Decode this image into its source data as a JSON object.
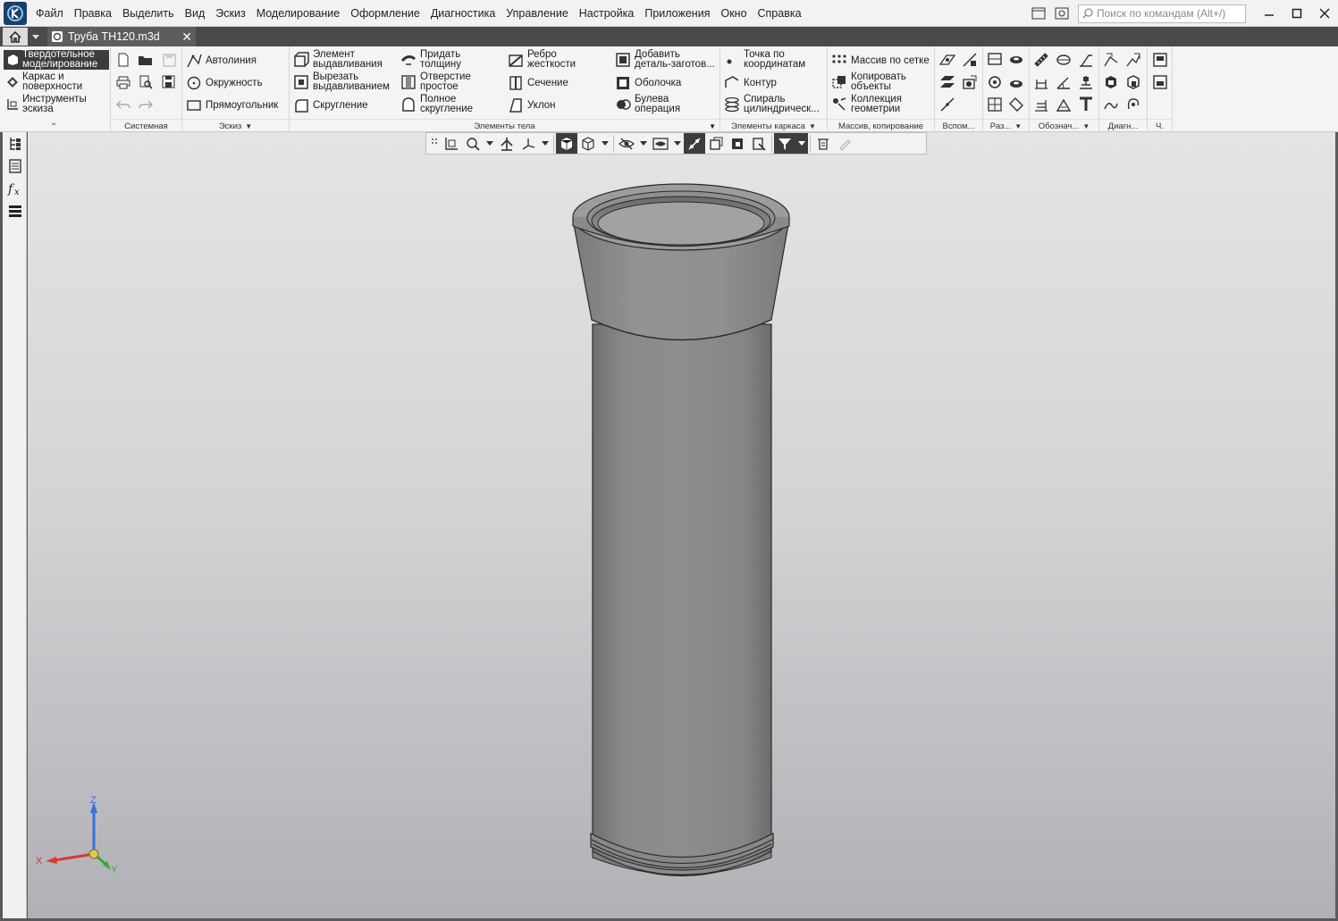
{
  "app": {
    "logo_name": "kompas-logo-icon",
    "menu": [
      "Файл",
      "Правка",
      "Выделить",
      "Вид",
      "Эскиз",
      "Моделирование",
      "Оформление",
      "Диагностика",
      "Управление",
      "Настройка",
      "Приложения",
      "Окно",
      "Справка"
    ],
    "search_placeholder": "Поиск по командам (Alt+/)",
    "minimize": "—",
    "maximize": "☐",
    "close": "✕"
  },
  "tabs": {
    "document_title": "Труба ТН120.m3d",
    "close": "✕"
  },
  "ribbon": {
    "modes": [
      "Твердотельное\nмоделирование",
      "Каркас и\nповерхности",
      "Инструменты\nэскиза"
    ],
    "groups": {
      "system": "Системная",
      "sketch": "Эскиз",
      "body": "Элементы тела",
      "frame": "Элементы каркаса",
      "array": "Массив, копирование",
      "aux": "Вспом...",
      "sections": "Раз...",
      "designations": "Обознач...",
      "diagnostics": "Диагн...",
      "ch": "Ч."
    },
    "sketch_items": [
      "Автолиния",
      "Окружность",
      "Прямоугольник"
    ],
    "body_items": {
      "extrude": "Элемент\nвыдавливания",
      "cut_extrude": "Вырезать\nвыдавливанием",
      "fillet": "Скругление",
      "thicken": "Придать\nтолщину",
      "hole": "Отверстие\nпростое",
      "full_round": "Полное\nскругление",
      "rib": "Ребро\nжесткости",
      "section": "Сечение",
      "draft": "Уклон",
      "add_part": "Добавить\nдеталь-заготов...",
      "shell": "Оболочка",
      "boolean": "Булева\nоперация"
    },
    "frame_items": {
      "point": "Точка по\nкоординатам",
      "contour": "Контур",
      "spiral": "Спираль\nцилиндрическ..."
    },
    "array_items": {
      "grid": "Массив по сетке",
      "copy": "Копировать\nобъекты",
      "collection": "Коллекция\nгеометрии"
    }
  },
  "viewport": {
    "axis_x": "X",
    "axis_y": "Y",
    "axis_z": "Z",
    "colors": {
      "axis_x": "#d63a3a",
      "axis_y": "#3aa53a",
      "axis_z": "#3a6fd6",
      "model": "#8c8c8c"
    }
  }
}
